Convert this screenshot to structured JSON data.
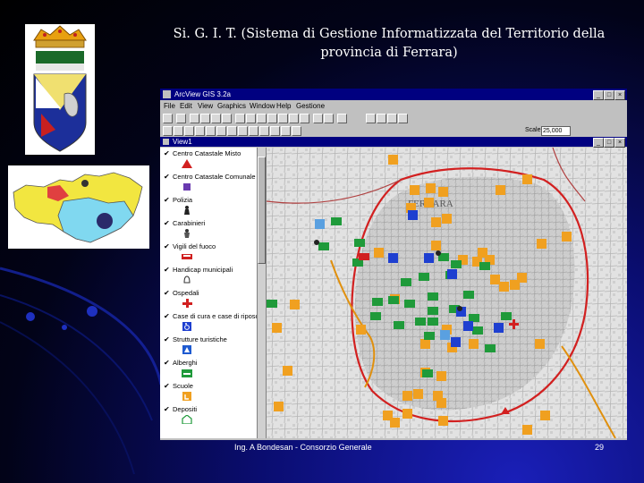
{
  "slide": {
    "title": "Si. G. I. T.  (Sistema di Gestione Informatizzata del Territorio della provincia di Ferrara)",
    "footer": "Ing. A Bondesan - Consorzio Generale",
    "page_number": "29"
  },
  "window": {
    "title": "ArcView GIS 3.2a",
    "menu": [
      "File",
      "Edit",
      "View",
      "Graphics",
      "Window",
      "Help",
      "Gestione"
    ],
    "scale_label": "Scale 1:",
    "scale_value": "25,000"
  },
  "view": {
    "title": "View1",
    "map_label": "FERRARA"
  },
  "legend": [
    {
      "label": "Centro Catastale Misto",
      "symbol": "red-triangle"
    },
    {
      "label": "Centro Catastale Comunale",
      "symbol": "purple-square"
    },
    {
      "label": "Polizia",
      "symbol": "police-figure"
    },
    {
      "label": "Carabinieri",
      "symbol": "carabinieri-figure"
    },
    {
      "label": "Vigili del fuoco",
      "symbol": "fire-truck"
    },
    {
      "label": "Handicap municipali",
      "symbol": "bell"
    },
    {
      "label": "Ospedali",
      "symbol": "red-cross"
    },
    {
      "label": "Case di cura e case di riposo",
      "symbol": "wheelchair"
    },
    {
      "label": "Strutture turistiche",
      "symbol": "tourism-triangle"
    },
    {
      "label": "Alberghi",
      "symbol": "green-bed"
    },
    {
      "label": "Scuole",
      "symbol": "orange-school"
    },
    {
      "label": "Depositi",
      "symbol": "green-building"
    }
  ],
  "colors": {
    "window_title": "#000080",
    "school_orange": "#f0a020",
    "hotel_green": "#1f9a3a",
    "handicap_blue": "#1e3fd0",
    "road_red": "#d22020",
    "river_orange": "#e0900e"
  }
}
